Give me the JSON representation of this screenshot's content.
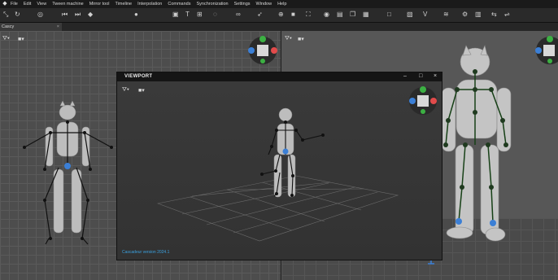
{
  "menu": [
    "File",
    "Edit",
    "View",
    "Tween machine",
    "Mirror tool",
    "Timeline",
    "Interpolation",
    "Commands",
    "Synchronization",
    "Settings",
    "Window",
    "Help"
  ],
  "tab": {
    "label": "Cascy",
    "close": "×"
  },
  "window": {
    "title": "VIEWPORT",
    "minimize": "–",
    "maximize": "□",
    "close": "×",
    "version": "Cascadeur version 2024.1"
  },
  "gizmo": {
    "y": "Y",
    "x": "X",
    "z": "Z"
  },
  "colors": {
    "accent": "#3aa1e0",
    "bone": "#1f3a1f",
    "joint_red": "#e24b4b",
    "joint_green": "#3cb043",
    "joint_blue": "#3b7fd6"
  },
  "icons": [
    "logo-icon",
    "move-icon",
    "rotate-icon",
    "select-icon",
    "camera-icon",
    "lock-icon",
    "settings-icon"
  ]
}
